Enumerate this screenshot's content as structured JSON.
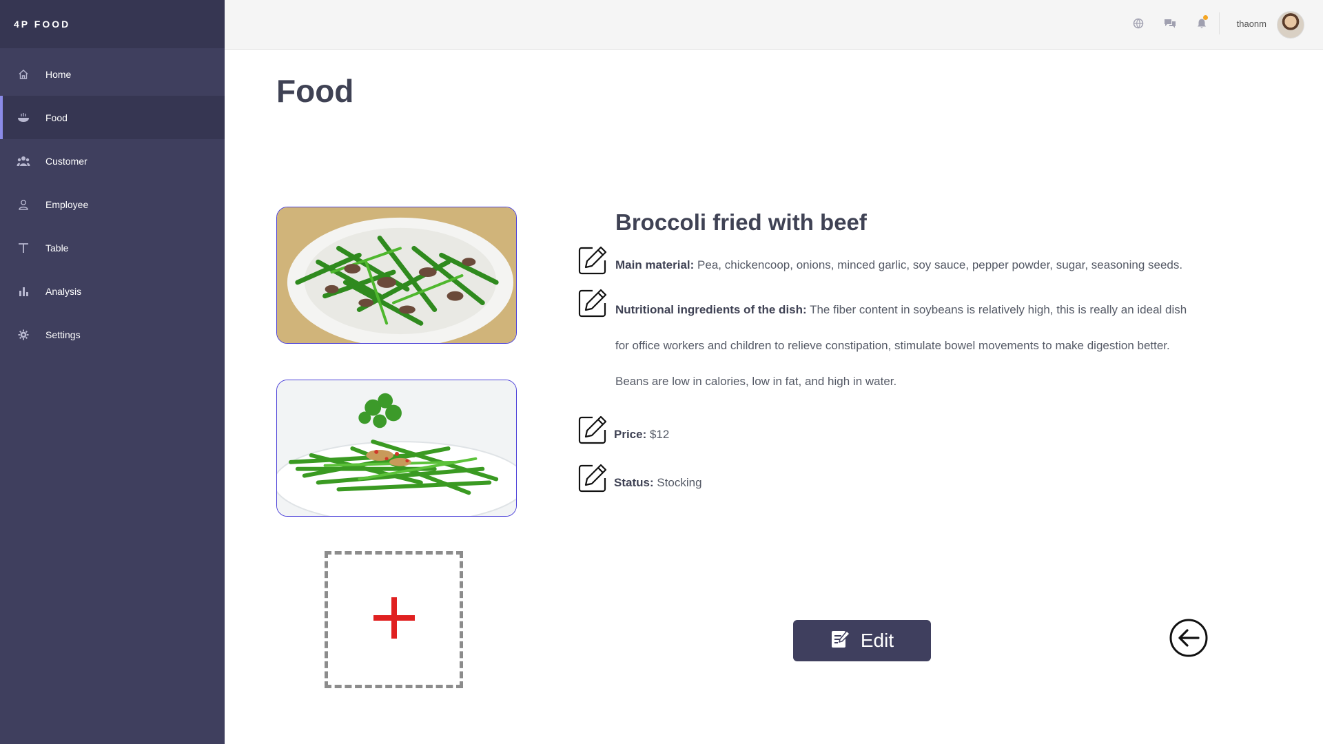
{
  "app": {
    "brand": "4P FOOD"
  },
  "sidebar": {
    "items": [
      {
        "label": "Home",
        "icon": "home-icon"
      },
      {
        "label": "Food",
        "icon": "food-bowl-icon",
        "active": true
      },
      {
        "label": "Customer",
        "icon": "users-icon"
      },
      {
        "label": "Employee",
        "icon": "user-icon"
      },
      {
        "label": "Table",
        "icon": "table-icon"
      },
      {
        "label": "Analysis",
        "icon": "bar-chart-icon"
      },
      {
        "label": "Settings",
        "icon": "gear-icon"
      }
    ]
  },
  "header": {
    "icons": [
      "globe-icon",
      "chat-icon",
      "bell-icon"
    ],
    "username": "thaonm"
  },
  "main": {
    "page_title": "Food",
    "dish": {
      "name": "Broccoli fried with beef",
      "main_material_label": "Main material:",
      "main_material": "Pea, chickencoop, onions, minced garlic, soy sauce, pepper powder, sugar, seasoning seeds.",
      "nutrition_label": "Nutritional ingredients of the dish:",
      "nutrition": "The fiber content in soybeans is relatively high, this is really an ideal dish for office workers and children to relieve constipation, stimulate bowel movements to make digestion better. Beans are low in calories, low in fat, and high in water.",
      "price_label": "Price:",
      "price": "$12",
      "status_label": "Status:",
      "status": "Stocking"
    },
    "edit_button": "Edit"
  },
  "colors": {
    "sidebar_bg": "#3f3f5e",
    "accent": "#8b8be8",
    "add_plus": "#e02020",
    "photo_border": "#4a3fd8",
    "notification": "#f5a623"
  }
}
